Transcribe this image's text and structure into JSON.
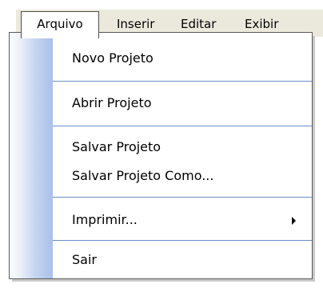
{
  "menubar": {
    "items": [
      {
        "label": "Arquivo",
        "active": true
      },
      {
        "label": "Inserir"
      },
      {
        "label": "Editar"
      },
      {
        "label": "Exibir"
      }
    ]
  },
  "dropdown": {
    "items": [
      {
        "label": "Novo Projeto"
      },
      {
        "label": "Abrir Projeto"
      },
      {
        "label": "Salvar Projeto"
      },
      {
        "label": "Salvar Projeto Como..."
      },
      {
        "label": "Imprimir...",
        "submenu_arrow": "right-triangle-icon"
      },
      {
        "label": "Sair"
      }
    ]
  },
  "colors": {
    "menubar_background": "#ebe9dc",
    "menu_background": "#ffffff",
    "separator": "#6d8fc9",
    "gutter_gradient_end": "#a9c0ea",
    "border": "#5a5a5a"
  }
}
